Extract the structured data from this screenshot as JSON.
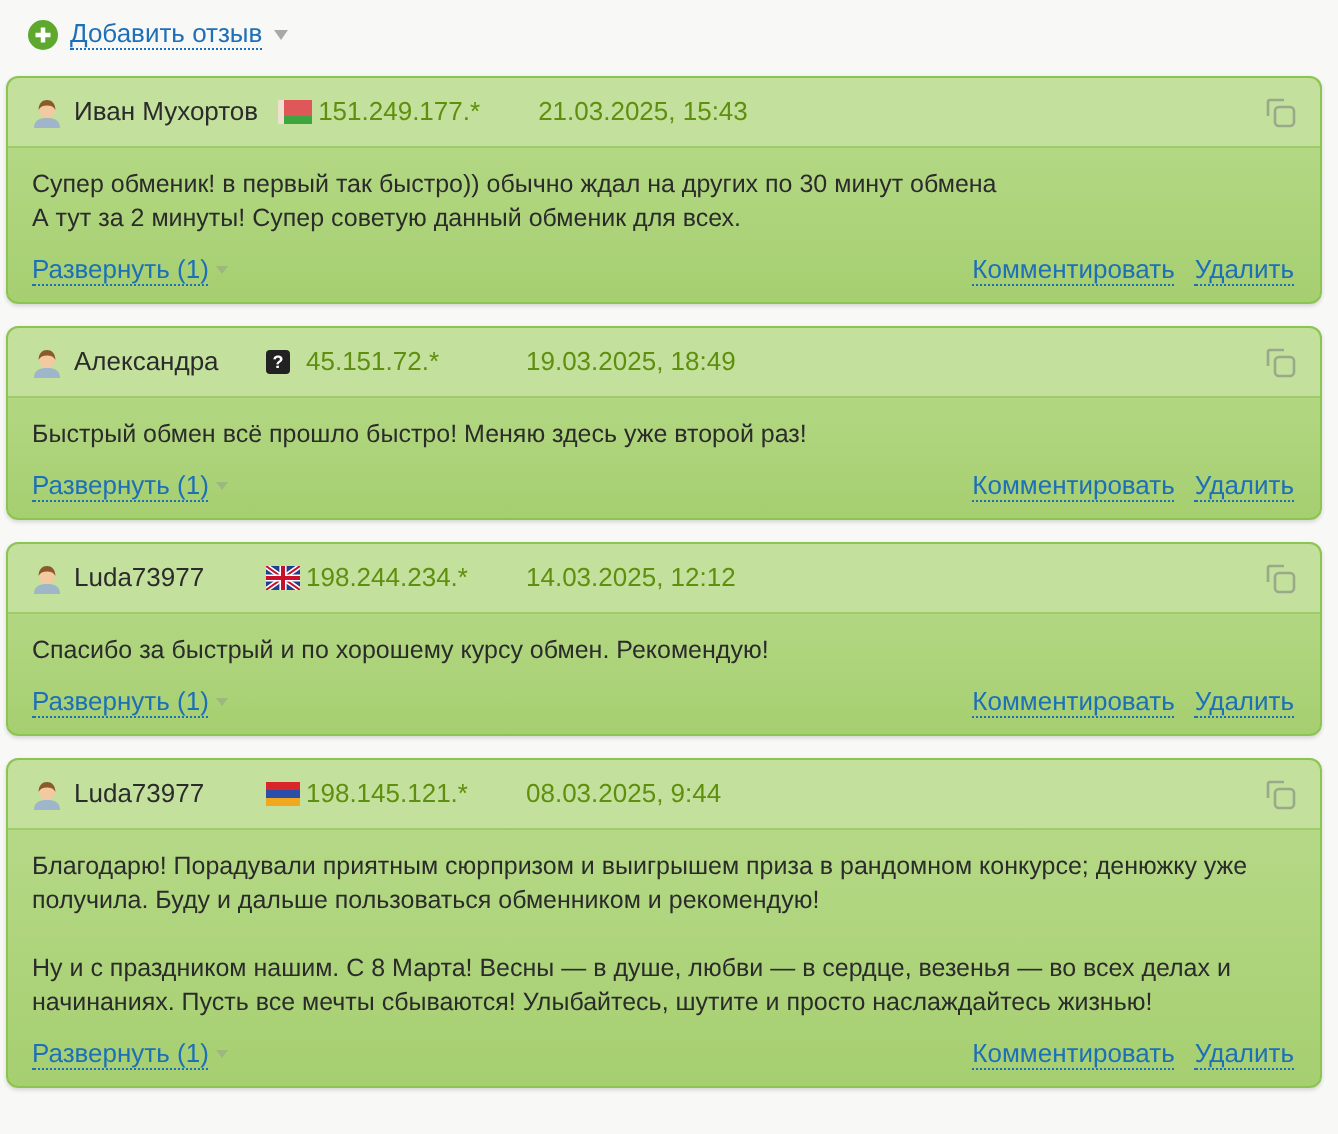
{
  "add_review": {
    "label": "Добавить отзыв"
  },
  "reviews": [
    {
      "author": "Иван Мухортов",
      "flag": {
        "kind": "by"
      },
      "ip": "151.249.177.*",
      "date": "21.03.2025, 15:43",
      "text": "Супер обменик! в первый так быстро)) обычно ждал на других по 30 минут обмена\nА тут за 2 минуты! Супер советую данный обменик для всех.",
      "expand": "Развернуть (1)",
      "comment": "Комментировать",
      "delete": "Удалить"
    },
    {
      "author": "Александра",
      "flag": {
        "kind": "unknown",
        "label": "?"
      },
      "ip": "45.151.72.*",
      "date": "19.03.2025, 18:49",
      "text": "Быстрый обмен всё прошло быстро! Меняю здесь уже второй раз!",
      "expand": "Развернуть (1)",
      "comment": "Комментировать",
      "delete": "Удалить"
    },
    {
      "author": "Luda73977",
      "flag": {
        "kind": "gb"
      },
      "ip": "198.244.234.*",
      "date": "14.03.2025, 12:12",
      "text": "Спасибо за быстрый и по хорошему курсу обмен. Рекомендую!",
      "expand": "Развернуть (1)",
      "comment": "Комментировать",
      "delete": "Удалить"
    },
    {
      "author": "Luda73977",
      "flag": {
        "kind": "am"
      },
      "ip": "198.145.121.*",
      "date": "08.03.2025, 9:44",
      "text": "Благодарю! Порадували приятным сюрпризом и выигрышем приза в рандомном конкурсе; денюжку уже получила. Буду и дальше пользоваться обменником и рекомендую!\n\nНу и с праздником нашим. С 8 Марта! Весны — в душе, любви — в сердце, везенья — во всех делах и начинаниях. Пусть все мечты сбываются! Улыбайтесь, шутите и просто наслаждайтесь жизнью!",
      "expand": "Развернуть (1)",
      "comment": "Комментировать",
      "delete": "Удалить"
    }
  ]
}
